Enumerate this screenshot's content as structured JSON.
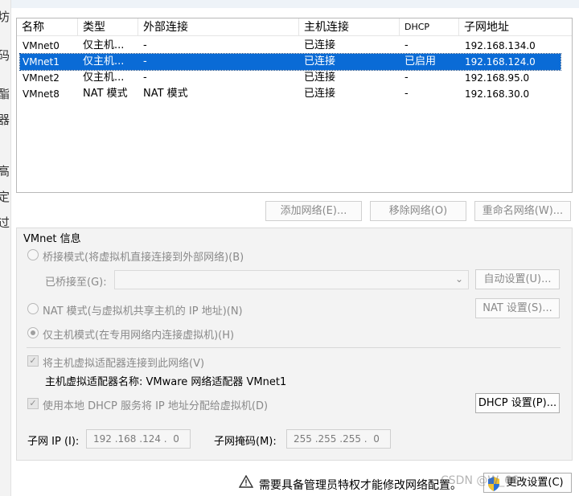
{
  "background_window": {
    "chars": [
      "坊",
      "码",
      "酯",
      "器",
      "高",
      "定",
      "过"
    ]
  },
  "table": {
    "columns": [
      "名称",
      "类型",
      "外部连接",
      "主机连接",
      "DHCP",
      "子网地址"
    ],
    "rows": [
      {
        "name": "VMnet0",
        "type": "仅主机...",
        "external": "-",
        "host": "已连接",
        "dhcp": "-",
        "subnet": "192.168.134.0"
      },
      {
        "name": "VMnet1",
        "type": "仅主机...",
        "external": "-",
        "host": "已连接",
        "dhcp": "已启用",
        "subnet": "192.168.124.0"
      },
      {
        "name": "VMnet2",
        "type": "仅主机...",
        "external": "-",
        "host": "已连接",
        "dhcp": "-",
        "subnet": "192.168.95.0"
      },
      {
        "name": "VMnet8",
        "type": "NAT 模式",
        "external": "NAT 模式",
        "host": "已连接",
        "dhcp": "-",
        "subnet": "192.168.30.0"
      }
    ],
    "selected_index": 1
  },
  "buttons": {
    "add_network": "添加网络(E)...",
    "remove_network": "移除网络(O)",
    "rename_network": "重命名网络(W)...",
    "auto_settings": "自动设置(U)...",
    "nat_settings": "NAT 设置(S)...",
    "dhcp_settings": "DHCP 设置(P)...",
    "change_settings": "更改设置(C)"
  },
  "vmnet_info": {
    "title": "VMnet 信息",
    "bridged_label": "桥接模式(将虚拟机直接连接到外部网络)(B)",
    "bridged_to_label": "已桥接至(G):",
    "bridged_to_value": "",
    "nat_label": "NAT 模式(与虚拟机共享主机的 IP 地址)(N)",
    "hostonly_label": "仅主机模式(在专用网络内连接虚拟机)(H)",
    "selected_mode": "hostonly",
    "connect_adapter_label": "将主机虚拟适配器连接到此网络(V)",
    "connect_adapter_checked": true,
    "adapter_name_label": "主机虚拟适配器名称: VMware 网络适配器 VMnet1",
    "dhcp_label": "使用本地 DHCP 服务将 IP 地址分配给虚拟机(D)",
    "dhcp_checked": true,
    "subnet_ip_label": "子网 IP (I):",
    "subnet_ip_value": "192 .168 .124 .  0",
    "subnet_mask_label": "子网掩码(M):",
    "subnet_mask_value": "255 .255 .255 .  0"
  },
  "footer": {
    "warning": "需要具备管理员特权才能修改网络配置。",
    "watermark": "CSDN @W_66"
  },
  "colors": {
    "selection": "#0a6bd6",
    "disabled_text": "#8a8a8a",
    "group_bg": "#f3f3f3"
  },
  "icons": {
    "warning": "warning-triangle-icon",
    "shield": "uac-shield-icon"
  }
}
